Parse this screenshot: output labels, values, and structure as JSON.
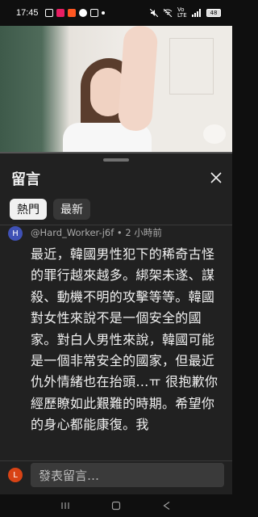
{
  "status_bar": {
    "time": "17:45",
    "network": "Vo LTE",
    "battery": "48"
  },
  "sheet": {
    "title": "留言",
    "chips": [
      "熱門",
      "最新"
    ],
    "active_chip": "熱門"
  },
  "comment": {
    "avatar_letter": "H",
    "meta": "@Hard_Worker-j6f • 2 小時前",
    "text": "最近，韓國男性犯下的稀奇古怪的罪行越來越多。綁架未遂、謀殺、動機不明的攻擊等等。韓國對女性來說不是一個安全的國家。對白人男性來說，韓國可能是一個非常安全的國家，但最近仇外情緒也在抬頭…ㅠ 很抱歉你經歷瞭如此艱難的時期。希望你的身心都能康復。我"
  },
  "composer": {
    "avatar_letter": "L",
    "placeholder": "發表留言…"
  },
  "colors": {
    "background": "#0f0f0f",
    "sheet": "#212121",
    "chip_active": "#f1f1f1",
    "avatar_comment": "#3f51b5",
    "avatar_me": "#d84315"
  }
}
